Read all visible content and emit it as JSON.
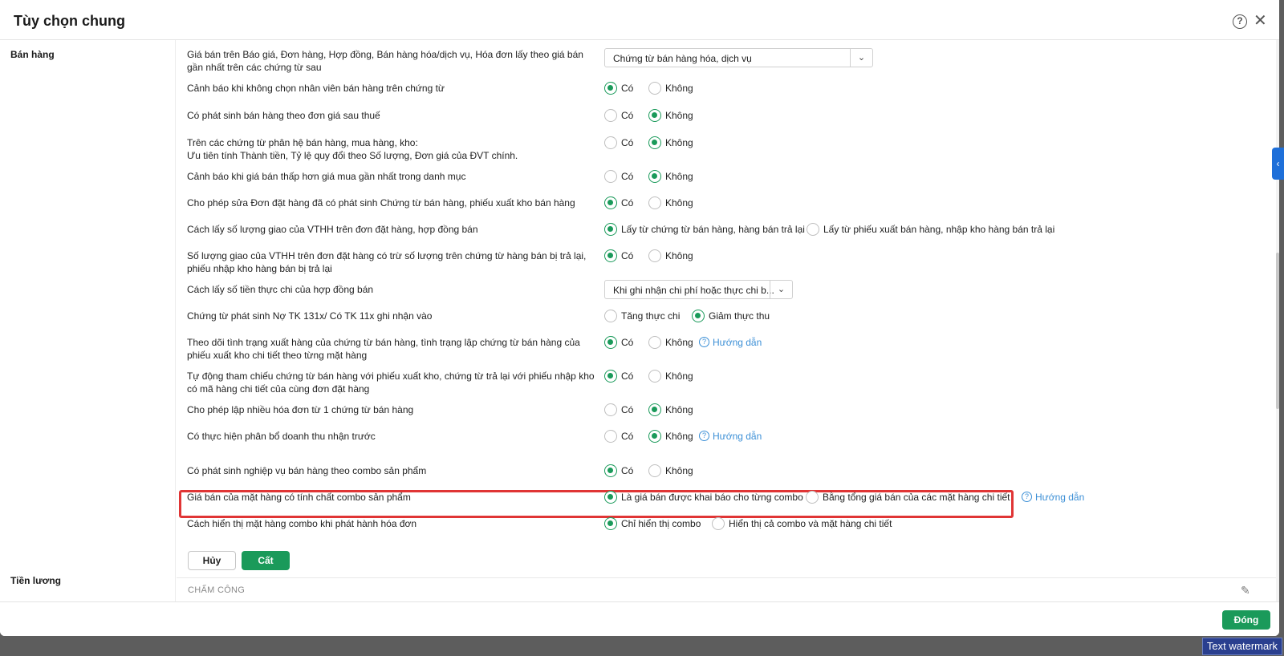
{
  "dialog": {
    "title": "Tùy chọn chung"
  },
  "sections": {
    "sales": "Bán hàng",
    "payroll": "Tiền lương"
  },
  "rows": [
    {
      "label": "Giá bán trên Báo giá, Đơn hàng, Hợp đồng, Bán hàng hóa/dịch vụ, Hóa đơn lấy theo giá bán gần nhất trên các chứng từ sau",
      "select": "Chứng từ bán hàng hóa, dịch vụ"
    },
    {
      "label": "Cảnh báo khi không chọn nhân viên bán hàng trên chứng từ",
      "opt1": "Có",
      "opt2": "Không"
    },
    {
      "label": "Có phát sinh bán hàng theo đơn giá sau thuế",
      "opt1": "Có",
      "opt2": "Không"
    },
    {
      "label": "Trên các chứng từ phân hệ bán hàng, mua hàng, kho:",
      "label2": "Ưu tiên tính Thành tiền, Tỷ lệ quy đổi theo Số lượng, Đơn giá của ĐVT chính.",
      "opt1": "Có",
      "opt2": "Không"
    },
    {
      "label": "Cảnh báo khi giá bán thấp hơn giá mua gần nhất trong danh mục",
      "opt1": "Có",
      "opt2": "Không"
    },
    {
      "label": "Cho phép sửa Đơn đặt hàng đã có phát sinh Chứng từ bán hàng, phiếu xuất kho bán hàng",
      "opt1": "Có",
      "opt2": "Không"
    },
    {
      "label": "Cách lấy số lượng giao của VTHH trên đơn đặt hàng, hợp đồng bán",
      "opt1": "Lấy từ chứng từ bán hàng, hàng bán trả lại",
      "opt2": "Lấy từ phiếu xuất bán hàng, nhập kho hàng bán trả lại"
    },
    {
      "label": "Số lượng giao của VTHH trên đơn đặt hàng có trừ số lượng trên chứng từ hàng bán bị trả lại, phiếu nhập kho hàng bán bị trả lại",
      "opt1": "Có",
      "opt2": "Không"
    },
    {
      "label": "Cách lấy số tiền thực chi của hợp đồng bán",
      "select": "Khi ghi nhận chi phí hoặc thực chi b..."
    },
    {
      "label": "Chứng từ phát sinh Nợ TK 131x/ Có TK 11x ghi nhận vào",
      "opt1": "Tăng thực chi",
      "opt2": "Giảm thực thu"
    },
    {
      "label": "Theo dõi tình trạng xuất hàng của chứng từ bán hàng, tình trạng lập chứng từ bán hàng của phiếu xuất kho chi tiết theo từng mặt hàng",
      "opt1": "Có",
      "opt2": "Không",
      "guide": "Hướng dẫn"
    },
    {
      "label": "Tự động tham chiếu chứng từ bán hàng với phiếu xuất kho, chứng từ trả lại với phiếu nhập kho có mã hàng chi tiết của cùng đơn đặt hàng",
      "opt1": "Có",
      "opt2": "Không"
    },
    {
      "label": "Cho phép lập nhiều hóa đơn từ 1 chứng từ bán hàng",
      "opt1": "Có",
      "opt2": "Không"
    },
    {
      "label": "Có thực hiện phân bổ doanh thu nhận trước",
      "opt1": "Có",
      "opt2": "Không",
      "guide": "Hướng dẫn"
    },
    {
      "label": "Có phát sinh nghiệp vụ bán hàng theo combo sản phẩm",
      "opt1": "Có",
      "opt2": "Không"
    },
    {
      "label": "Giá bán của mặt hàng có tính chất combo sản phẩm",
      "opt1": "Là giá bán được khai báo cho từng combo",
      "opt2": "Bằng tổng giá bán của các mặt hàng chi tiết",
      "guide": "Hướng dẫn"
    },
    {
      "label": "Cách hiển thị mặt hàng combo khi phát hành hóa đơn",
      "opt1": "Chỉ hiển thị combo",
      "opt2": "Hiển thị cả combo và mặt hàng chi tiết"
    }
  ],
  "buttons": {
    "cancel": "Hủy",
    "save": "Cất",
    "close": "Đóng"
  },
  "payroll": {
    "subheading": "CHẤM CÔNG"
  },
  "watermark": "Text watermark",
  "colors": {
    "accent": "#1a9a5a",
    "highlight": "#e03535",
    "link": "#3b8fd6"
  }
}
